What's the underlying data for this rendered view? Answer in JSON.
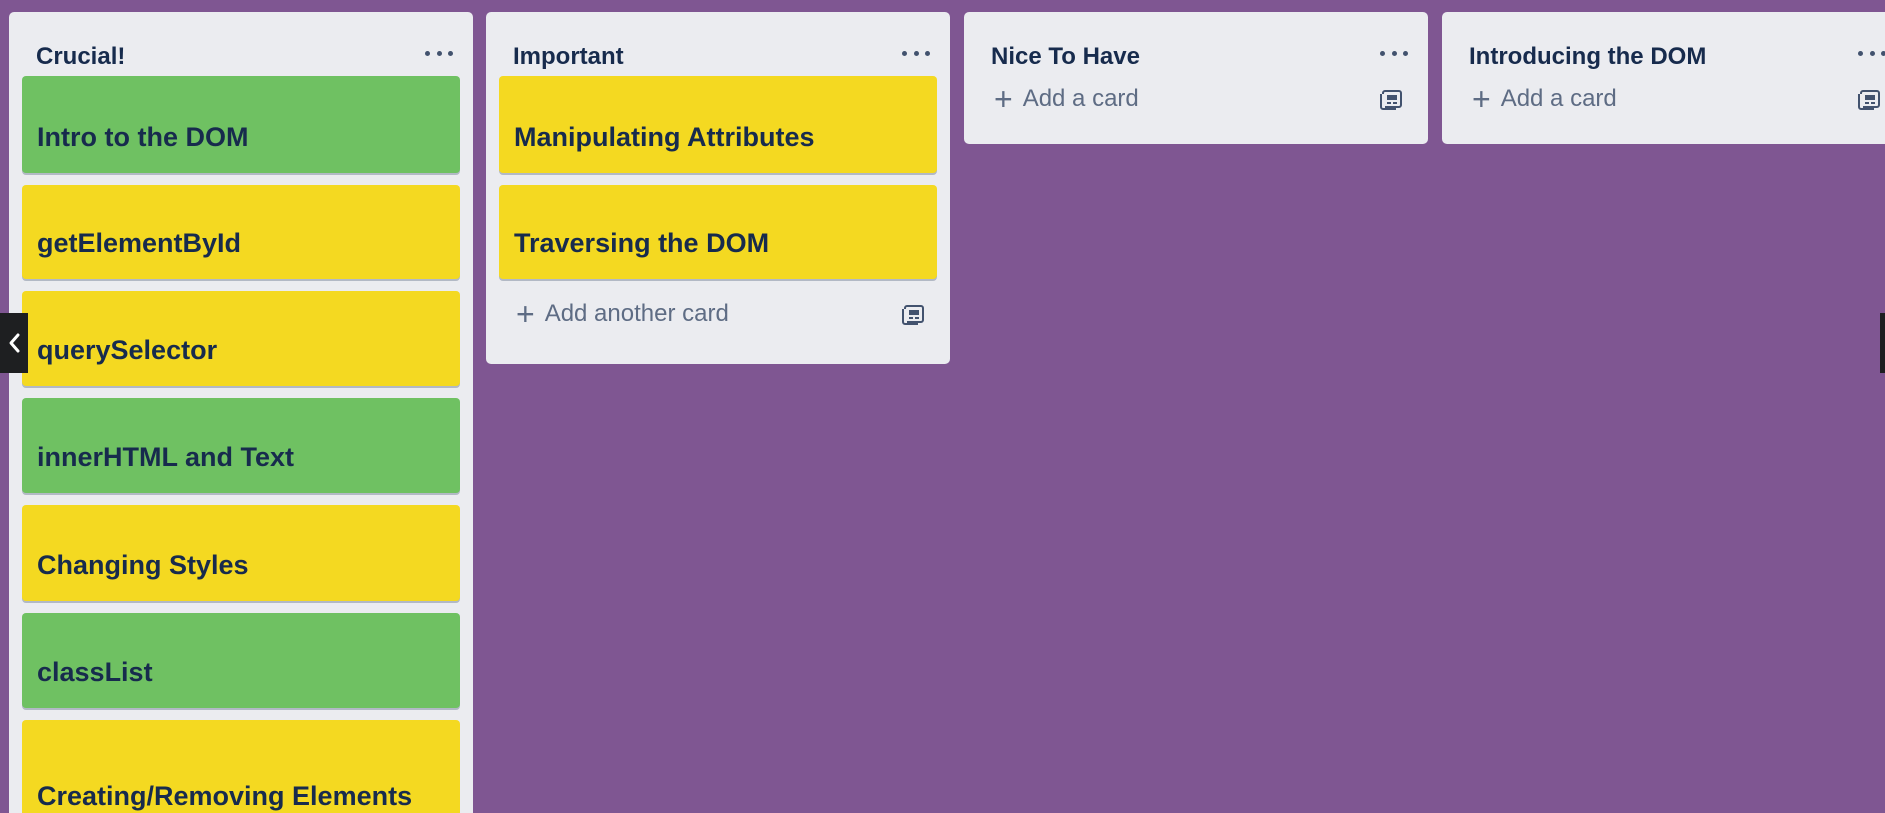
{
  "colors": {
    "background": "#7f5692",
    "list_bg": "#ebecf0",
    "green_label": "#6fc162",
    "yellow_label": "#f4d921",
    "text": "#172b4d"
  },
  "lists": [
    {
      "title": "Crucial!",
      "cards": [
        {
          "title": "Intro to the DOM",
          "color": "green"
        },
        {
          "title": "getElementById",
          "color": "yellow"
        },
        {
          "title": "querySelector",
          "color": "yellow"
        },
        {
          "title": "innerHTML and Text",
          "color": "green"
        },
        {
          "title": "Changing Styles",
          "color": "yellow"
        },
        {
          "title": "classList",
          "color": "green"
        },
        {
          "title": "Creating/Removing Elements",
          "color": "yellow"
        }
      ]
    },
    {
      "title": "Important",
      "cards": [
        {
          "title": "Manipulating Attributes",
          "color": "yellow"
        },
        {
          "title": "Traversing the DOM",
          "color": "yellow"
        }
      ],
      "add_label": "Add another card"
    },
    {
      "title": "Nice To Have",
      "cards": [],
      "add_label": "Add a card"
    },
    {
      "title": "Introducing the DOM",
      "cards": [],
      "add_label": "Add a card"
    }
  ],
  "icons": {
    "menu": "ellipsis-icon",
    "add": "plus-icon",
    "template": "card-template-icon",
    "collapse": "chevron-left-icon"
  }
}
